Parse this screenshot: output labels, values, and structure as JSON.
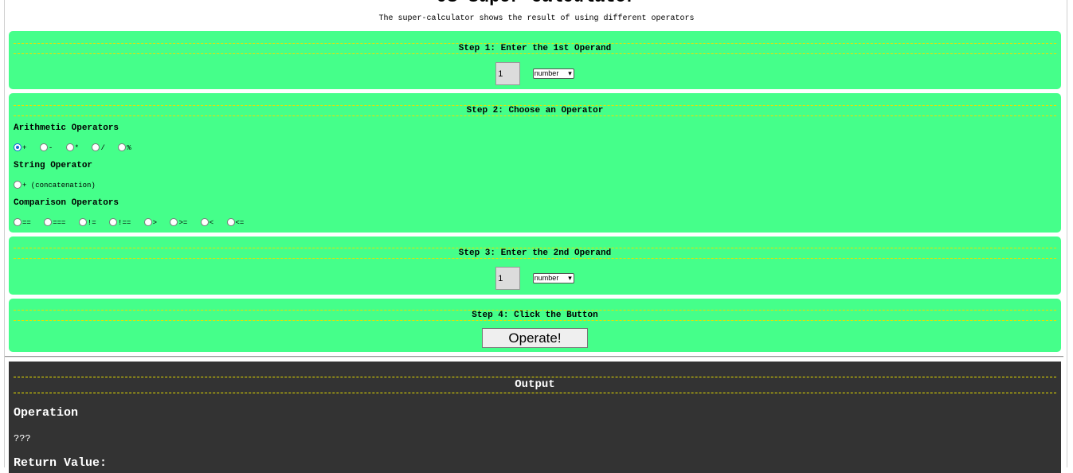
{
  "header": {
    "title": "JS Super Calculator",
    "subtitle": "The super-calculator shows the result of using different operators"
  },
  "step1": {
    "heading": "Step 1: Enter the 1st Operand",
    "value": "1",
    "type": "number"
  },
  "step2": {
    "heading": "Step 2: Choose an Operator",
    "arithmetic_label": "Arithmetic Operators",
    "arithmetic": [
      "+",
      "-",
      "*",
      "/",
      "%"
    ],
    "string_label": "String Operator",
    "string": [
      "+ (concatenation)"
    ],
    "comparison_label": "Comparison Operators",
    "comparison": [
      "==",
      "===",
      "!=",
      "!==",
      ">",
      ">=",
      "<",
      "<="
    ],
    "selected": "+"
  },
  "step3": {
    "heading": "Step 3: Enter the 2nd Operand",
    "value": "1",
    "type": "number"
  },
  "step4": {
    "heading": "Step 4: Click the Button",
    "button_label": "Operate!"
  },
  "output": {
    "heading": "Output",
    "operation_label": "Operation",
    "operation_value": "???",
    "return_label": "Return Value:"
  },
  "colors": {
    "panel": "#45ff8a",
    "dash": "#e8e000",
    "output_bg": "#333333",
    "radio_selected": "#1565d8"
  }
}
